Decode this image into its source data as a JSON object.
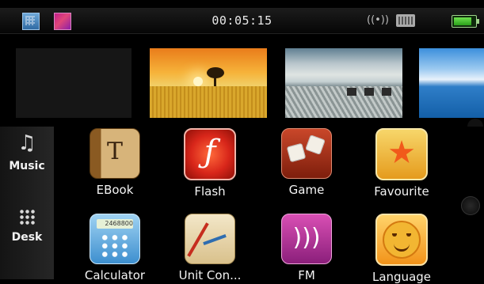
{
  "status_bar": {
    "time": "00:05:15",
    "icons": [
      "calculator-icon",
      "picture-icon",
      "signal-icon",
      "network-icon",
      "battery-icon"
    ]
  },
  "thumbnails": [
    {
      "name": "empty-slot"
    },
    {
      "name": "sunset-field"
    },
    {
      "name": "beach-deck"
    },
    {
      "name": "sea-sky"
    }
  ],
  "sidebar": {
    "items": [
      {
        "label": "Music",
        "icon": "music-note-icon"
      },
      {
        "label": "Desk",
        "icon": "grid-icon"
      }
    ]
  },
  "apps": [
    {
      "label": "EBook",
      "icon": "ebook-icon"
    },
    {
      "label": "Flash",
      "icon": "flash-icon"
    },
    {
      "label": "Game",
      "icon": "dice-icon"
    },
    {
      "label": "Favourite",
      "icon": "star-icon"
    },
    {
      "label": "Calculator",
      "icon": "calculator-icon"
    },
    {
      "label": "Unit Con...",
      "icon": "ruler-icon"
    },
    {
      "label": "FM",
      "icon": "radio-icon"
    },
    {
      "label": "Language",
      "icon": "smiley-icon"
    }
  ],
  "calculator_display": "2468800"
}
